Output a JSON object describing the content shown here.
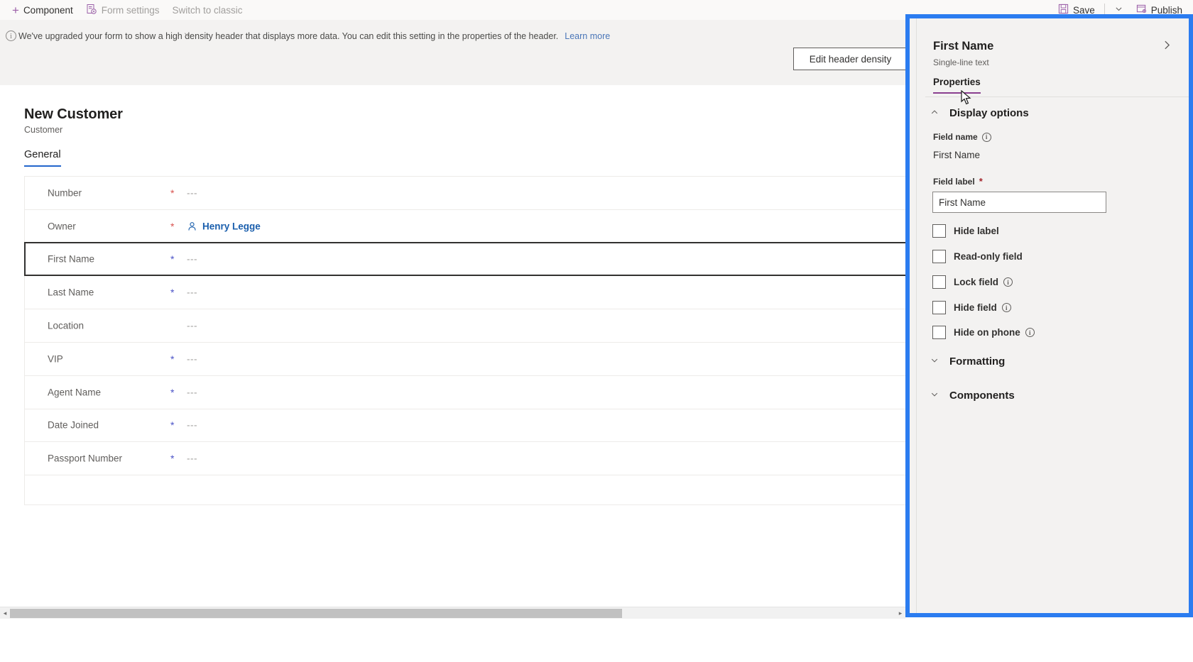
{
  "command_bar": {
    "left_items": [
      {
        "label": "Component",
        "icon": "plus-icon",
        "disabled": false
      },
      {
        "label": "Form settings",
        "icon": "form-settings-icon",
        "disabled": true
      },
      {
        "label": "Switch to classic",
        "icon": "",
        "disabled": true
      }
    ],
    "right_items": [
      {
        "label": "Save",
        "icon": "save-icon"
      },
      {
        "label": "",
        "icon": "chevron-down-icon"
      },
      {
        "label": "Publish",
        "icon": "publish-icon"
      }
    ]
  },
  "notification": {
    "icon": "info-icon",
    "message": "We've upgraded your form to show a high density header that displays more data. You can edit this setting in the properties of the header.",
    "link_label": "Learn more",
    "close_label": "×"
  },
  "density_strip": {
    "button_label": "Edit header density"
  },
  "form": {
    "title": "New Customer",
    "subtitle": "Customer",
    "tabs": [
      {
        "label": "General",
        "active": true
      }
    ],
    "rows": [
      {
        "label": "Number",
        "star": "req",
        "value": "---",
        "type": "text",
        "selected": false
      },
      {
        "label": "Owner",
        "star": "req",
        "value": "Henry Legge",
        "type": "owner",
        "selected": false
      },
      {
        "label": "First Name",
        "star": "biz",
        "value": "---",
        "type": "text",
        "selected": true
      },
      {
        "label": "Last Name",
        "star": "biz",
        "value": "---",
        "type": "text",
        "selected": false
      },
      {
        "label": "Location",
        "star": "",
        "value": "---",
        "type": "text",
        "selected": false
      },
      {
        "label": "VIP",
        "star": "biz",
        "value": "---",
        "type": "text",
        "selected": false
      },
      {
        "label": "Agent Name",
        "star": "biz",
        "value": "---",
        "type": "text",
        "selected": false
      },
      {
        "label": "Date Joined",
        "star": "biz",
        "value": "---",
        "type": "text",
        "selected": false
      },
      {
        "label": "Passport Number",
        "star": "biz",
        "value": "---",
        "type": "text",
        "selected": false
      }
    ]
  },
  "properties_panel": {
    "title": "First Name",
    "subtitle": "Single-line text",
    "expand_icon": "chevron-right-icon",
    "tabs": [
      {
        "label": "Properties",
        "active": true
      }
    ],
    "sections": [
      {
        "name": "display-options",
        "title": "Display options",
        "expanded": true,
        "chevron": "chevron-up-icon"
      },
      {
        "name": "formatting",
        "title": "Formatting",
        "expanded": false,
        "chevron": "chevron-down-icon"
      },
      {
        "name": "components",
        "title": "Components",
        "expanded": false,
        "chevron": "chevron-down-icon"
      }
    ],
    "field_name": {
      "label": "Field name",
      "info": true,
      "value": "First Name"
    },
    "field_label": {
      "label": "Field label",
      "required": true,
      "value": "First Name",
      "placeholder": "First Name"
    },
    "checkboxes": [
      {
        "label": "Hide label",
        "checked": false,
        "info": false
      },
      {
        "label": "Read-only field",
        "checked": false,
        "info": false
      },
      {
        "label": "Lock field",
        "checked": false,
        "info": true
      },
      {
        "label": "Hide field",
        "checked": false,
        "info": true
      },
      {
        "label": "Hide on phone",
        "checked": false,
        "info": true
      }
    ]
  },
  "scrollbar": {
    "left_arrow": "◂",
    "right_arrow": "▸"
  },
  "colors": {
    "accent_purple": "#8a3f8f",
    "brand_plus": "#9b5fa8",
    "tab_underline_blue": "#2266cc",
    "highlight_border": "#2b7cf0",
    "required_red": "#d9534f",
    "business_blue": "#4a52c7",
    "link_blue": "#4a76b8",
    "owner_link": "#1b5fad",
    "panel_bg": "#f3f2f1"
  }
}
